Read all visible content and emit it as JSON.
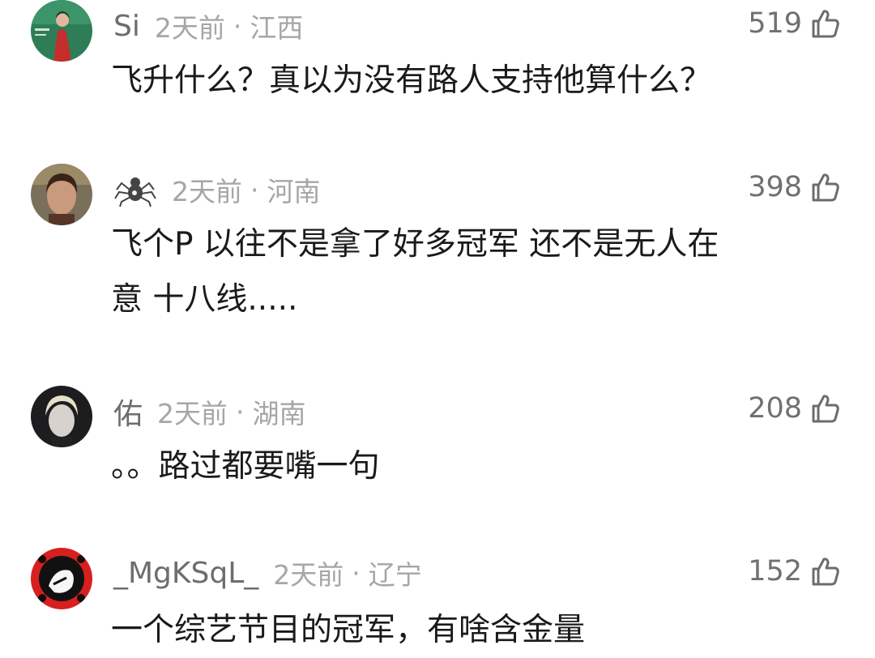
{
  "comments": [
    {
      "username": "Si",
      "time": "2天前",
      "separator": "·",
      "location": "江西",
      "likes": "519",
      "text": "飞升什么？真以为没有路人支持他算什么？"
    },
    {
      "username": "",
      "username_icon": "spider-icon",
      "time": "2天前",
      "separator": "·",
      "location": "河南",
      "likes": "398",
      "text": "飞个P 以往不是拿了好多冠军 还不是无人在\n意 十八线....."
    },
    {
      "username": "佑",
      "time": "2天前",
      "separator": "·",
      "location": "湖南",
      "likes": "208",
      "text": "。。路过都要嘴一句"
    },
    {
      "username": "_MgKSqL_",
      "time": "2天前",
      "separator": "·",
      "location": "辽宁",
      "likes": "152",
      "text": "一个综艺节目的冠军，有啥含金量"
    }
  ]
}
